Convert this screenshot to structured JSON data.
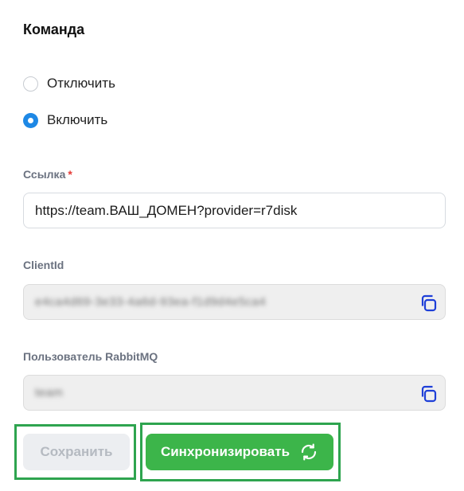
{
  "section": {
    "title": "Команда"
  },
  "mode": {
    "options": [
      {
        "label": "Отключить",
        "selected": false
      },
      {
        "label": "Включить",
        "selected": true
      }
    ]
  },
  "fields": {
    "link": {
      "label": "Ссылка",
      "required_mark": "*",
      "value": "https://team.ВАШ_ДОМЕН?provider=r7disk"
    },
    "client_id": {
      "label": "ClientId",
      "value": "e4ca4d69-3e33-4a6d-93ea-f1d9d4e5ca4",
      "copy_icon": "copy-icon"
    },
    "rabbit_user": {
      "label": "Пользователь RabbitMQ",
      "value": "team",
      "copy_icon": "copy-icon"
    }
  },
  "actions": {
    "save_label": "Сохранить",
    "sync_label": "Синхронизировать",
    "sync_icon": "refresh-icon"
  },
  "colors": {
    "accent_blue": "#1e88e5",
    "sync_green": "#3cb54a",
    "highlight_frame": "#2ea44f",
    "required_red": "#e53935"
  }
}
